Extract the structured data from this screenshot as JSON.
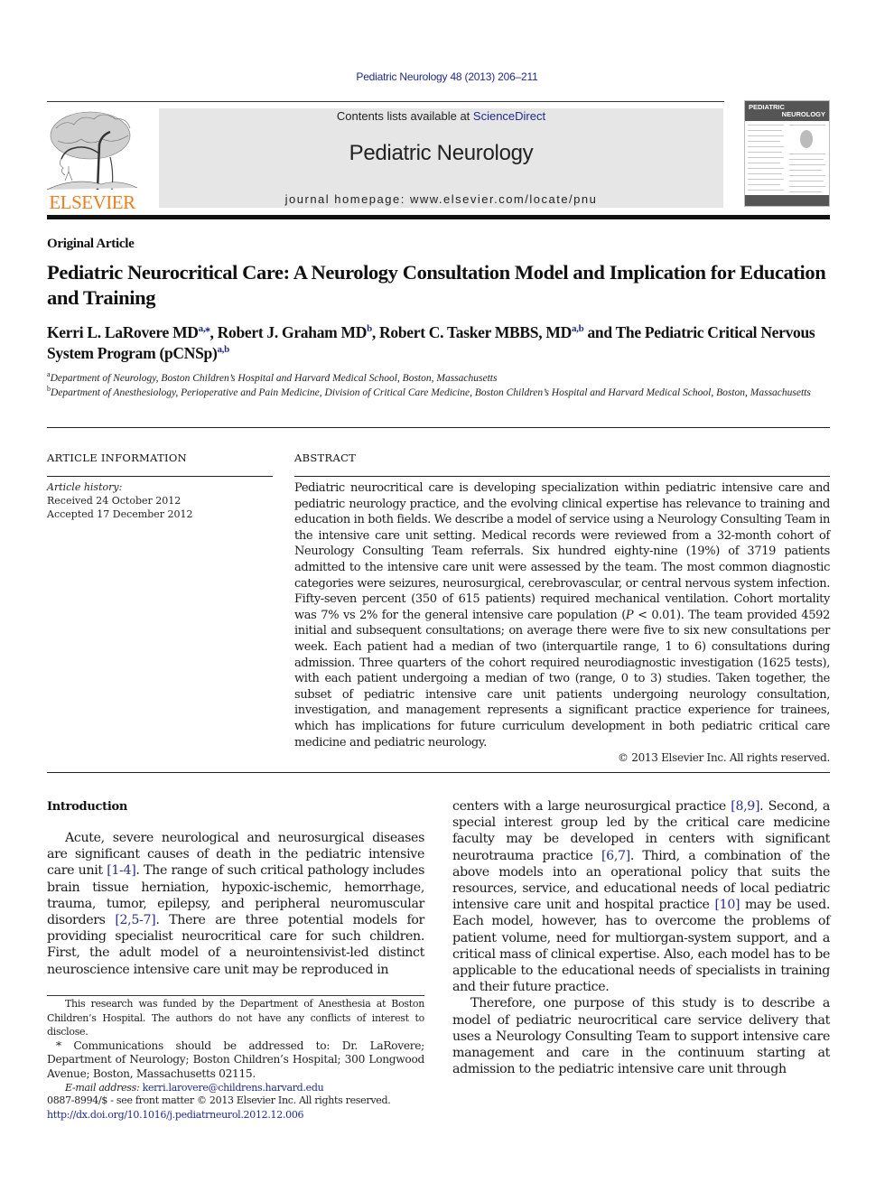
{
  "header": {
    "journal_citation": "Pediatric Neurology 48 (2013) 206–211",
    "contents_prefix": "Contents lists available at ",
    "contents_link": "ScienceDirect",
    "journal_name": "Pediatric Neurology",
    "homepage": "journal homepage: www.elsevier.com/locate/pnu",
    "publisher_wordmark": "ELSEVIER",
    "cover": {
      "line1": "PEDIATRIC",
      "line2": "NEUROLOGY"
    }
  },
  "article": {
    "type": "Original Article",
    "title": "Pediatric Neurocritical Care: A Neurology Consultation Model and Implication for Education and Training",
    "authors": [
      {
        "name": "Kerri L. LaRovere MD",
        "sup": "a,⁎",
        "sep": ", "
      },
      {
        "name": "Robert J. Graham MD",
        "sup": "b",
        "sep": ", "
      },
      {
        "name": "Robert C. Tasker MBBS, MD",
        "sup": "a,b",
        "sep": " and "
      },
      {
        "name": "The Pediatric Critical Nervous System Program (pCNSp)",
        "sup": "a,b",
        "sep": ""
      }
    ],
    "affiliations": [
      {
        "key": "a",
        "text": "Department of Neurology, Boston Children’s Hospital and Harvard Medical School, Boston, Massachusetts"
      },
      {
        "key": "b",
        "text": "Department of Anesthesiology, Perioperative and Pain Medicine, Division of Critical Care Medicine, Boston Children’s Hospital and Harvard Medical School, Boston, Massachusetts"
      }
    ]
  },
  "article_info": {
    "heading": "ARTICLE INFORMATION",
    "history_label": "Article history:",
    "received": "Received 24 October 2012",
    "accepted": "Accepted 17 December 2012"
  },
  "abstract": {
    "heading": "ABSTRACT",
    "text_before_p": "Pediatric neurocritical care is developing specialization within pediatric intensive care and pediatric neurology practice, and the evolving clinical expertise has relevance to training and education in both fields. We describe a model of service using a Neurology Consulting Team in the intensive care unit setting. Medical records were reviewed from a 32-month cohort of Neurology Consulting Team referrals. Six hundred eighty-nine (19%) of 3719 patients admitted to the intensive care unit were assessed by the team. The most common diagnostic categories were seizures, neurosurgical, cerebrovascular, or central nervous system infection. Fifty-seven percent (350 of 615 patients) required mechanical ventilation. Cohort mortality was 7% vs 2% for the general intensive care population (",
    "p_symbol": "P",
    "text_after_p": " < 0.01). The team provided 4592 initial and subsequent consultations; on average there were five to six new consultations per week. Each patient had a median of two (interquartile range, 1 to 6) consultations during admission. Three quarters of the cohort required neurodiagnostic investigation (1625 tests), with each patient undergoing a median of two (range, 0 to 3) studies. Taken together, the subset of pediatric intensive care unit patients undergoing neurology consultation, investigation, and management represents a significant practice experience for trainees, which has implications for future curriculum development in both pediatric critical care medicine and pediatric neurology.",
    "copyright": "© 2013 Elsevier Inc. All rights reserved."
  },
  "body": {
    "intro_heading": "Introduction",
    "left_p1": {
      "t1": "Acute, severe neurological and neurosurgical diseases are significant causes of death in the pediatric intensive care unit ",
      "c1": "[1-4]",
      "t2": ". The range of such critical pathology includes brain tissue herniation, hypoxic-ischemic, hemorrhage, trauma, tumor, epilepsy, and peripheral neuromuscular disorders ",
      "c2": "[2,5-7]",
      "t3": ". There are three potential models for providing specialist neurocritical care for such children. First, the adult model of a neurointensivist-led distinct neuroscience intensive care unit may be reproduced in"
    },
    "right_p1": {
      "t1": "centers with a large neurosurgical practice ",
      "c1": "[8,9]",
      "t2": ". Second, a special interest group led by the critical care medicine faculty may be developed in centers with significant neurotrauma practice ",
      "c2": "[6,7]",
      "t3": ". Third, a combination of the above models into an operational policy that suits the resources, service, and educational needs of local pediatric intensive care unit and hospital practice ",
      "c3": "[10]",
      "t4": " may be used. Each model, however, has to overcome the problems of patient volume, need for multiorgan-system support, and a critical mass of clinical expertise. Also, each model has to be applicable to the educational needs of specialists in training and their future practice."
    },
    "right_p2": "Therefore, one purpose of this study is to describe a model of pediatric neurocritical care service delivery that uses a Neurology Consulting Team to support intensive care management and care in the continuum starting at admission to the pediatric intensive care unit through"
  },
  "footnotes": {
    "funding": "This research was funded by the Department of Anesthesia at Boston Children’s Hospital. The authors do not have any conflicts of interest to disclose.",
    "correspondence_mark": "*",
    "correspondence": " Communications should be addressed to: Dr. LaRovere; Department of Neurology; Boston Children’s Hospital; 300 Longwood Avenue; Boston, Massachusetts 02115.",
    "email_label": "E-mail address: ",
    "email": "kerri.larovere@childrens.harvard.edu",
    "front_matter": "0887-8994/$ - see front matter © 2013 Elsevier Inc. All rights reserved.",
    "doi": "http://dx.doi.org/10.1016/j.pediatrneurol.2012.12.006"
  },
  "colors": {
    "link": "#1f2a8a",
    "elsevier_orange": "#f07c1b",
    "banner_gray": "#e6e6e6"
  }
}
